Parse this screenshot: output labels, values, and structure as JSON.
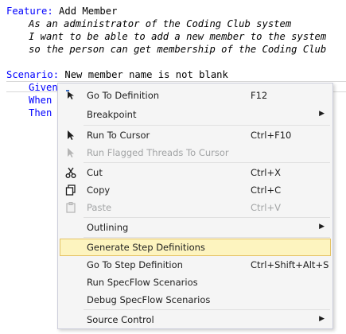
{
  "editor": {
    "feature_keyword": "Feature:",
    "feature_title": " Add Member",
    "description": [
      "As an administrator of the Coding Club system",
      "I want to be able to add a new member to the system",
      "so the person can get membership of the Coding Club"
    ],
    "scenario_keyword": "Scenario:",
    "scenario_title": " New member name is not blank",
    "steps": [
      "Given",
      "When",
      "Then"
    ],
    "step_tails": [
      "e",
      "ll",
      ""
    ]
  },
  "context_menu": {
    "items": [
      {
        "label": "Go To Definition",
        "shortcut": "F12",
        "icon": "go-to-definition-icon",
        "enabled": true,
        "submenu": false
      },
      {
        "label": "Breakpoint",
        "shortcut": "",
        "icon": "",
        "enabled": true,
        "submenu": true
      },
      {
        "label": "Run To Cursor",
        "shortcut": "Ctrl+F10",
        "icon": "run-to-cursor-icon",
        "enabled": true,
        "submenu": false
      },
      {
        "label": "Run Flagged Threads To Cursor",
        "shortcut": "",
        "icon": "run-flagged-threads-icon",
        "enabled": false,
        "submenu": false
      },
      {
        "label": "Cut",
        "shortcut": "Ctrl+X",
        "icon": "scissors-icon",
        "enabled": true,
        "submenu": false
      },
      {
        "label": "Copy",
        "shortcut": "Ctrl+C",
        "icon": "copy-icon",
        "enabled": true,
        "submenu": false
      },
      {
        "label": "Paste",
        "shortcut": "Ctrl+V",
        "icon": "paste-icon",
        "enabled": false,
        "submenu": false
      },
      {
        "label": "Outlining",
        "shortcut": "",
        "icon": "",
        "enabled": true,
        "submenu": true
      },
      {
        "label": "Generate Step Definitions",
        "shortcut": "",
        "icon": "",
        "enabled": true,
        "submenu": false,
        "highlighted": true
      },
      {
        "label": "Go To Step Definition",
        "shortcut": "Ctrl+Shift+Alt+S",
        "icon": "",
        "enabled": true,
        "submenu": false
      },
      {
        "label": "Run SpecFlow Scenarios",
        "shortcut": "",
        "icon": "",
        "enabled": true,
        "submenu": false
      },
      {
        "label": "Debug SpecFlow Scenarios",
        "shortcut": "",
        "icon": "",
        "enabled": true,
        "submenu": false
      },
      {
        "label": "Source Control",
        "shortcut": "",
        "icon": "",
        "enabled": true,
        "submenu": true
      }
    ],
    "submenu_glyph": "▶"
  },
  "colors": {
    "keyword": "#0000ff",
    "menu_background": "#f5f5f5",
    "highlight": "#fdf4bf",
    "disabled_text": "#a2a4a5"
  }
}
